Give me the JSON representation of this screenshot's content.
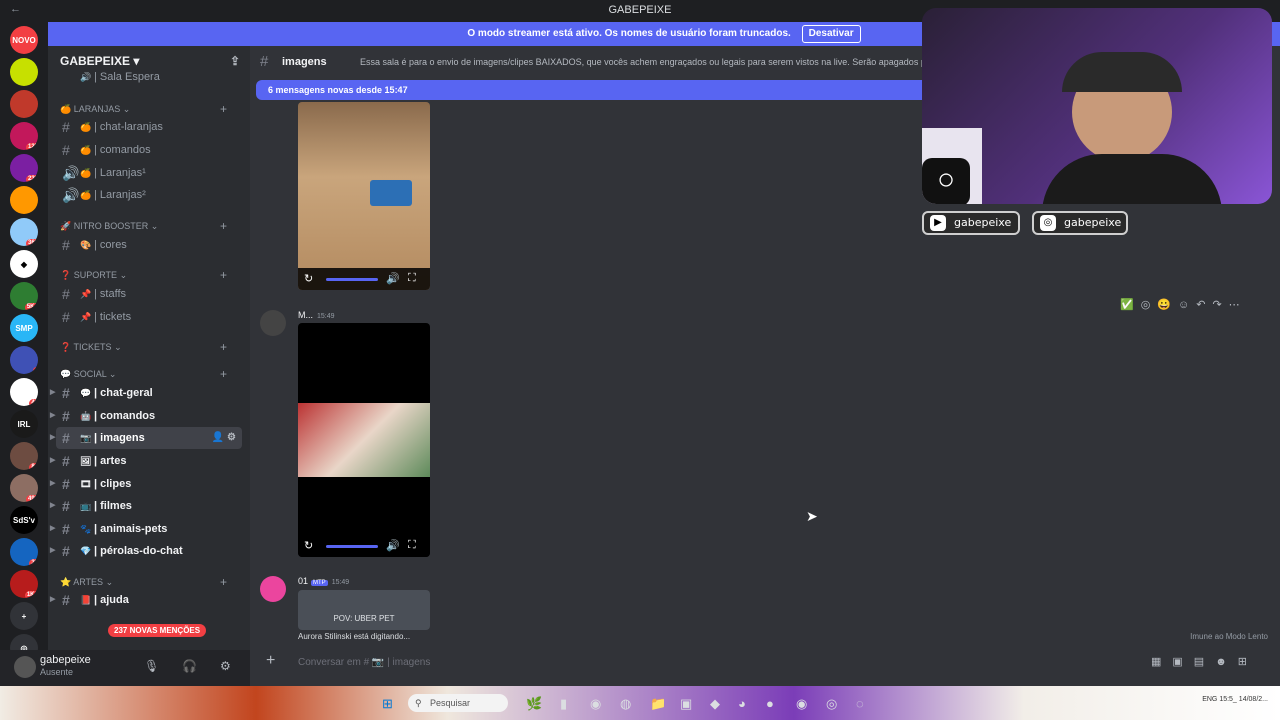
{
  "window": {
    "title": "GABEPEIXE",
    "back": "←"
  },
  "banner": {
    "text": "O modo streamer está ativo. Os nomes de usuário foram truncados.",
    "button": "Desativar"
  },
  "servers": [
    {
      "label": "NOVO",
      "color": "#f23f43",
      "badge": ""
    },
    {
      "label": "",
      "color": "#c7e000",
      "badge": ""
    },
    {
      "label": "",
      "color": "#c0392b",
      "badge": ""
    },
    {
      "label": "",
      "color": "#c2185b",
      "badge": "125"
    },
    {
      "label": "",
      "color": "#7b1fa2",
      "badge": "239"
    },
    {
      "label": "",
      "color": "#ff9800",
      "badge": ""
    },
    {
      "label": "",
      "color": "#90caf9",
      "badge": "363"
    },
    {
      "label": "◆",
      "color": "#ffffff",
      "badge": ""
    },
    {
      "label": "",
      "color": "#2e7d32",
      "badge": "5K+"
    },
    {
      "label": "SMP",
      "color": "#29b6f6",
      "badge": ""
    },
    {
      "label": "",
      "color": "#3f51b5",
      "badge": "4"
    },
    {
      "label": "",
      "color": "#ffffff",
      "badge": "42"
    },
    {
      "label": "IRL",
      "color": "#1a1a1a",
      "badge": ""
    },
    {
      "label": "",
      "color": "#6d4c41",
      "badge": "84"
    },
    {
      "label": "",
      "color": "#8d6e63",
      "badge": "490"
    },
    {
      "label": "SdS'v",
      "color": "#000000",
      "badge": ""
    },
    {
      "label": "",
      "color": "#1565c0",
      "badge": "32"
    },
    {
      "label": "",
      "color": "#b71c1c",
      "badge": "1K+"
    },
    {
      "label": "+",
      "color": "#313338",
      "badge": ""
    },
    {
      "label": "◎",
      "color": "#313338",
      "badge": ""
    }
  ],
  "guild": {
    "name": "GABEPEIXE ▾",
    "add_icon": "⇪"
  },
  "channels": {
    "partial": "| Sala Espera",
    "categories": {
      "laranjas": "LARANJAS",
      "nitro": "NITRO BOOSTER",
      "suporte": "SUPORTE",
      "tickets": "TICKETS",
      "social": "SOCIAL",
      "artes": "ARTES"
    },
    "items": {
      "chat_laranjas": "| chat-laranjas",
      "comandos1": "| comandos",
      "laranjas1": "| Laranjas¹",
      "laranjas2": "| Laranjas²",
      "cores": "| cores",
      "staffs": "| staffs",
      "tickets": "| tickets",
      "chat_geral": "| chat-geral",
      "comandos2": "| comandos",
      "imagens": "| imagens",
      "artes": "| artes",
      "clipes": "| clipes",
      "filmes": "| filmes",
      "animais": "| animais-pets",
      "perolas": "| pérolas-do-chat",
      "ajuda": "| ajuda"
    }
  },
  "mentions": "237 NOVAS MENÇÕES",
  "user": {
    "name": "gabepeixe",
    "status": "Ausente"
  },
  "topic": {
    "name": "imagens",
    "desc": "Essa sala é para o envio de imagens/clipes BAIXADOS, que vocês achem engraçados ou legais para serem vistos na live. Serão apagados print"
  },
  "new_messages": "6 mensagens novas desde 15:47",
  "messages": [
    {
      "author": "M...",
      "time": "15:49",
      "tag": ""
    },
    {
      "author": "01",
      "time": "15:49",
      "tag": "MTP"
    }
  ],
  "video3_caption": "POV: UBER PET",
  "typing": "Aurora Stilinski está digitando...",
  "immune": "Imune ao Modo Lento",
  "composer": {
    "placeholder": "Conversar em # 📷 | imagens"
  },
  "stream": {
    "youtube": "gabepeixe",
    "instagram": "gabepeixe"
  },
  "taskbar": {
    "search": "Pesquisar",
    "lang": "ENG",
    "time": "15:5_",
    "date": "14/08/2..."
  }
}
